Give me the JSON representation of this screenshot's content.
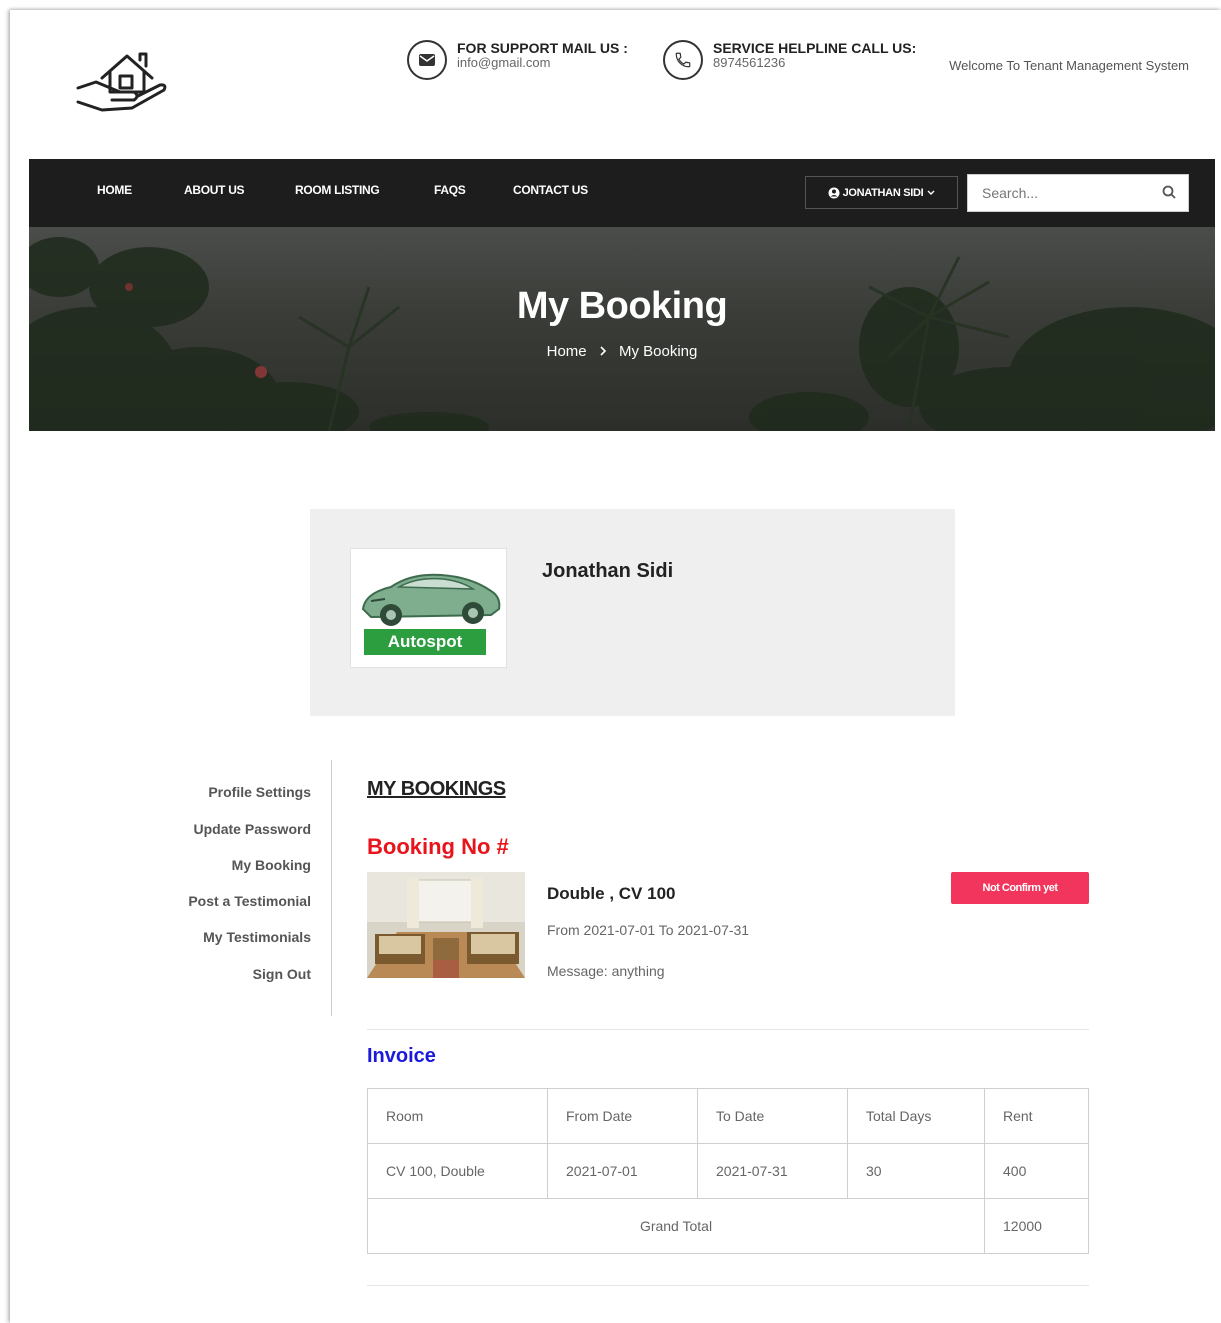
{
  "header": {
    "support_label": "FOR SUPPORT MAIL US :",
    "support_email": "info@gmail.com",
    "helpline_label": "SERVICE HELPLINE CALL US:",
    "helpline_phone": "8974561236",
    "welcome": "Welcome To Tenant Management System"
  },
  "nav": {
    "items": [
      "HOME",
      "ABOUT US",
      "ROOM LISTING",
      "FAQS",
      "CONTACT US"
    ],
    "user": "JONATHAN SIDI",
    "search_placeholder": "Search..."
  },
  "hero": {
    "title": "My Booking",
    "breadcrumb": [
      "Home",
      "My Booking"
    ]
  },
  "profile": {
    "name": "Jonathan Sidi",
    "avatar_badge": "Autospot"
  },
  "sidebar": {
    "items": [
      "Profile Settings",
      "Update Password",
      "My Booking",
      "Post a Testimonial",
      "My Testimonials",
      "Sign Out"
    ]
  },
  "bookings": {
    "section_title": "MY BOOKINGS",
    "booking_no": "Booking No #",
    "room_name": "Double , CV 100",
    "dates": "From 2021-07-01 To 2021-07-31",
    "message": "Message: anything",
    "status": "Not Confirm yet"
  },
  "invoice": {
    "title": "Invoice",
    "headers": [
      "Room",
      "From Date",
      "To Date",
      "Total Days",
      "Rent"
    ],
    "row": [
      "CV 100, Double",
      "2021-07-01",
      "2021-07-31",
      "30",
      "400"
    ],
    "grand_total_label": "Grand Total",
    "grand_total_value": "12000"
  },
  "colors": {
    "navbar": "#1d1d1d",
    "booking_no": "#e8141b",
    "status_badge": "#f2355d",
    "invoice_title": "#1a1adc",
    "autospot_badge": "#2c9e3f"
  }
}
